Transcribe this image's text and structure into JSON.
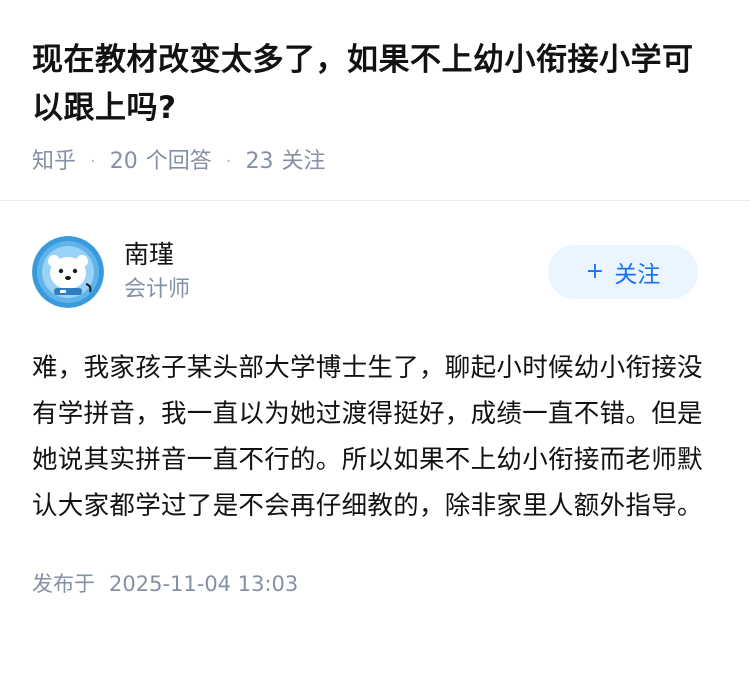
{
  "question": {
    "title": "现在教材改变太多了，如果不上幼小衔接小学可以跟上吗?",
    "source": "知乎",
    "answer_count": "20",
    "answer_label": "个回答",
    "follow_count": "23",
    "follow_label": "关注"
  },
  "answer": {
    "author_name": "南瑾",
    "author_desc": "会计师",
    "follow_button_label": "关注",
    "content": "难，我家孩子某头部大学博士生了，聊起小时候幼小衔接没有学拼音，我一直以为她过渡得挺好，成绩一直不错。但是她说其实拼音一直不行的。所以如果不上幼小衔接而老师默认大家都学过了是不会再仔细教的，除非家里人额外指导。",
    "publish_label": "发布于",
    "publish_time": "2025-11-04 13:03"
  },
  "colors": {
    "title": "#121212",
    "meta": "#8590a6",
    "accent": "#1772f6",
    "follow_bg": "#ebf5ff",
    "avatar_bg": "#3a9bdc"
  },
  "icons": {
    "avatar": "bear-avatar",
    "follow": "plus-icon"
  }
}
